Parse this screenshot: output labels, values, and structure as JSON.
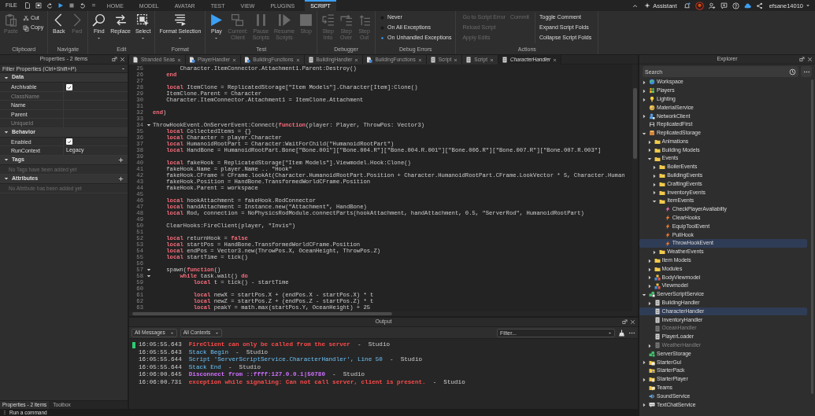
{
  "menu": {
    "file": "FILE",
    "tabs": [
      {
        "label": "HOME",
        "selected": false
      },
      {
        "label": "MODEL",
        "selected": false
      },
      {
        "label": "AVATAR",
        "selected": false
      },
      {
        "label": "TEST",
        "selected": false
      },
      {
        "label": "VIEW",
        "selected": false
      },
      {
        "label": "PLUGINS",
        "selected": false
      },
      {
        "label": "SCRIPT",
        "selected": true
      }
    ]
  },
  "account": {
    "assistant": "Assistant",
    "user": "efsane14010"
  },
  "ribbon": [
    {
      "label": "Clipboard",
      "kind": "buttons",
      "buttons": [
        {
          "lines": [
            "Paste"
          ],
          "kind": "large",
          "disabled": true,
          "dropdown": false
        },
        {
          "lines": [
            "Cut"
          ],
          "kind": "small",
          "disabled": false,
          "dropdown": false
        },
        {
          "lines": [
            "Copy"
          ],
          "kind": "small",
          "disabled": false,
          "dropdown": false
        }
      ]
    },
    {
      "label": "Navigate",
      "kind": "buttons",
      "buttons": [
        {
          "lines": [
            "Back"
          ],
          "kind": "large",
          "disabled": false,
          "dropdown": false
        },
        {
          "lines": [
            "Fwd"
          ],
          "kind": "large",
          "disabled": true,
          "dropdown": false
        }
      ]
    },
    {
      "label": "Edit",
      "kind": "buttons",
      "buttons": [
        {
          "lines": [
            "Find"
          ],
          "kind": "large",
          "disabled": false,
          "dropdown": true
        },
        {
          "lines": [
            "Replace"
          ],
          "kind": "large",
          "disabled": false,
          "dropdown": false
        },
        {
          "lines": [
            "Select"
          ],
          "kind": "large",
          "disabled": false,
          "dropdown": true
        }
      ]
    },
    {
      "label": "Format",
      "kind": "buttons",
      "buttons": [
        {
          "lines": [
            "Format Selection"
          ],
          "kind": "large",
          "disabled": false,
          "dropdown": true
        }
      ]
    },
    {
      "label": "Test",
      "kind": "buttons",
      "buttons": [
        {
          "lines": [
            "Play"
          ],
          "kind": "large",
          "disabled": false,
          "dropdown": true
        },
        {
          "lines": [
            "Current:",
            "Client"
          ],
          "kind": "large",
          "disabled": true,
          "dropdown": false
        },
        {
          "lines": [
            "Pause",
            "Scripts"
          ],
          "kind": "large",
          "disabled": true,
          "dropdown": false
        },
        {
          "lines": [
            "Resume",
            "Scripts"
          ],
          "kind": "large",
          "disabled": true,
          "dropdown": false
        },
        {
          "lines": [
            "Stop"
          ],
          "kind": "large",
          "disabled": true,
          "dropdown": false
        }
      ]
    },
    {
      "label": "Debugger",
      "kind": "buttons",
      "buttons": [
        {
          "lines": [
            "Step",
            "Into"
          ],
          "kind": "large",
          "disabled": true,
          "dropdown": false
        },
        {
          "lines": [
            "Step",
            "Over"
          ],
          "kind": "large",
          "disabled": true,
          "dropdown": false
        },
        {
          "lines": [
            "Step",
            "Out"
          ],
          "kind": "large",
          "disabled": true,
          "dropdown": false
        }
      ]
    },
    {
      "label": "Debug Errors",
      "kind": "radios",
      "options": [
        {
          "label": "Never",
          "selected": false
        },
        {
          "label": "On All Exceptions",
          "selected": false
        },
        {
          "label": "On Unhandled Exceptions",
          "selected": true
        }
      ]
    },
    {
      "label": "Actions",
      "kind": "actions",
      "columns": [
        [
          [
            {
              "label": "Go to Script Error",
              "disabled": true
            },
            {
              "label": "Commit",
              "disabled": true
            }
          ],
          [
            {
              "label": "Reload Script",
              "disabled": true
            }
          ],
          [
            {
              "label": "Apply Edits",
              "disabled": true
            }
          ]
        ],
        [
          [
            {
              "label": "Toggle Comment",
              "disabled": false
            }
          ],
          [
            {
              "label": "Expand Script Folds",
              "disabled": false
            }
          ],
          [
            {
              "label": "Collapse Script Folds",
              "disabled": false
            }
          ]
        ]
      ]
    }
  ],
  "properties": {
    "title": "Properties - 2 items",
    "filter": {
      "placeholder": "Filter Properties (Ctrl+Shift+P)"
    },
    "sections": [
      {
        "title": "Data",
        "expanded": true,
        "addable": false,
        "rows": [
          {
            "name": "Archivable",
            "kind": "checkbox",
            "checked": true,
            "disabled": false
          },
          {
            "name": "ClassName",
            "kind": "text",
            "disabled": true
          },
          {
            "name": "Name",
            "kind": "text",
            "disabled": false
          },
          {
            "name": "Parent",
            "kind": "text",
            "disabled": false
          },
          {
            "name": "UniqueId",
            "kind": "text",
            "disabled": true
          }
        ]
      },
      {
        "title": "Behavior",
        "expanded": true,
        "addable": false,
        "rows": [
          {
            "name": "Enabled",
            "kind": "checkbox",
            "checked": true,
            "disabled": false
          },
          {
            "name": "RunContext",
            "kind": "text",
            "value": "Legacy",
            "disabled": false
          }
        ]
      },
      {
        "title": "Tags",
        "expanded": true,
        "addable": true,
        "empty_text": "No Tags have been added yet"
      },
      {
        "title": "Attributes",
        "expanded": true,
        "addable": true,
        "empty_text": "No Attribute has been added yet"
      }
    ],
    "tabs": [
      {
        "label": "Properties - 2 items",
        "selected": true
      },
      {
        "label": "Toolbox",
        "selected": false
      }
    ]
  },
  "editor": {
    "tabs": [
      {
        "label": "Stranded Seas",
        "kind": "place",
        "selected": false,
        "preview": false
      },
      {
        "label": "PlayerHandler",
        "kind": "module",
        "selected": false,
        "preview": false
      },
      {
        "label": "BuildingFunctions",
        "kind": "module",
        "selected": false,
        "preview": false
      },
      {
        "label": "BuildingHandler",
        "kind": "script",
        "selected": false,
        "preview": false
      },
      {
        "label": "BuildingFunctions",
        "kind": "module",
        "selected": false,
        "preview": false
      },
      {
        "label": "Script",
        "kind": "script",
        "selected": false,
        "preview": false
      },
      {
        "label": "Script",
        "kind": "script",
        "selected": false,
        "preview": false
      },
      {
        "label": "CharacterHandler",
        "kind": "script",
        "selected": true,
        "preview": true
      }
    ],
    "lines": [
      {
        "n": "25",
        "foldable": false,
        "code": "        Character.ItemConnector.Attachment1.Parent:Destroy()"
      },
      {
        "n": "26",
        "foldable": false,
        "code": "    **end**"
      },
      {
        "n": "27",
        "foldable": false
      },
      {
        "n": "28",
        "foldable": false,
        "code": "    **local** ItemClone = ReplicatedStorage[\"Item Models\"].Character[Item]:Clone()"
      },
      {
        "n": "29",
        "foldable": false,
        "code": "    ItemClone.Parent = Character"
      },
      {
        "n": "30",
        "foldable": false,
        "code": "    Character.ItemConnector.Attachment1 = ItemClone.Attachment"
      },
      {
        "n": "31",
        "foldable": false
      },
      {
        "n": "32",
        "foldable": false,
        "code": "**end**)"
      },
      {
        "n": "33",
        "foldable": false
      },
      {
        "n": "34",
        "foldable": true,
        "code": "ThrowHookEvent.OnServerEvent:Connect(**function**(player: Player, ThrowPos: Vector3)"
      },
      {
        "n": "35",
        "foldable": false,
        "code": "    **local** CollectedItems = {}"
      },
      {
        "n": "36",
        "foldable": false,
        "code": "    **local** Character = player.Character"
      },
      {
        "n": "37",
        "foldable": false,
        "code": "    **local** HumanoidRootPart = Character:WaitForChild(\"HumanoidRootPart\")"
      },
      {
        "n": "38",
        "foldable": false,
        "code": "    **local** HandBone = HumanoidRootPart.Bone[\"Bone.001\"][\"Bone.004.R\"][\"Bone.004.R.001\"][\"Bone.006.R\"][\"Bone.007.R\"][\"Bone.007.R.003\"]"
      },
      {
        "n": "39",
        "foldable": false
      },
      {
        "n": "40",
        "foldable": false,
        "code": "    **local** fakeHook = ReplicatedStorage[\"Item Models\"].Viewmodel.Hook:Clone()"
      },
      {
        "n": "41",
        "foldable": false,
        "code": "    fakeHook.Name = player.Name .. \"Hook\""
      },
      {
        "n": "42",
        "foldable": false,
        "code": "    fakeHook.CFrame = CFrame.lookAt(Character.HumanoidRootPart.Position + Character.HumanoidRootPart.CFrame.LookVector * 5, Character.Human"
      },
      {
        "n": "43",
        "foldable": false,
        "code": "    fakeHook.Position = HandBone.TransformedWorldCFrame.Position"
      },
      {
        "n": "44",
        "foldable": false,
        "code": "    fakeHook.Parent = workspace"
      },
      {
        "n": "45",
        "foldable": false
      },
      {
        "n": "46",
        "foldable": false,
        "code": "    **local** hookAttachment = fakeHook.RodConnector"
      },
      {
        "n": "47",
        "foldable": false,
        "code": "    **local** handAttachment = Instance.new(\"Attachment\", HandBone)"
      },
      {
        "n": "48",
        "foldable": false,
        "code": "    **local** Rod, connection = NoPhysicsRodModule.connectParts(hookAttachment, handAttachment, 0.5, \"ServerRod\", HumanoidRootPart)"
      },
      {
        "n": "49",
        "foldable": false
      },
      {
        "n": "50",
        "foldable": false,
        "code": "    ClearHooks:FireClient(player, \"Invis\")"
      },
      {
        "n": "51",
        "foldable": false
      },
      {
        "n": "52",
        "foldable": false,
        "code": "    **local** returnHook = **false**"
      },
      {
        "n": "53",
        "foldable": false,
        "code": "    **local** startPos = HandBone.TransformedWorldCFrame.Position"
      },
      {
        "n": "54",
        "foldable": false,
        "code": "    **local** endPos = Vector3.new(ThrowPos.X, OceanHeight, ThrowPos.Z)"
      },
      {
        "n": "55",
        "foldable": false,
        "code": "    **local** startTime = tick()"
      },
      {
        "n": "56",
        "foldable": false
      },
      {
        "n": "57",
        "foldable": true,
        "code": "    spawn(**function**()"
      },
      {
        "n": "58",
        "foldable": true,
        "code": "        **while** task.wait() **do**"
      },
      {
        "n": "59",
        "foldable": false,
        "code": "            **local** t = tick() - startTime"
      },
      {
        "n": "60",
        "foldable": false
      },
      {
        "n": "61",
        "foldable": false,
        "code": "            **local** newX = startPos.X + (endPos.X - startPos.X) * t"
      },
      {
        "n": "62",
        "foldable": false,
        "code": "            **local** newZ = startPos.Z + (endPos.Z - startPos.Z) * t"
      },
      {
        "n": "63",
        "foldable": false,
        "code": "            **local** peakY = math.max(startPos.Y, OceanHeight) + 25"
      }
    ]
  },
  "output": {
    "title": "Output",
    "filters": [
      {
        "label": "All Messages"
      },
      {
        "label": "All Contexts"
      }
    ],
    "search": {
      "placeholder": "Filter..."
    },
    "messages": [
      {
        "time": "16:05:55.643",
        "text": "FireClient can only be called from the server",
        "source": "-  Studio",
        "kind": "error",
        "marked": true
      },
      {
        "time": "16:05:55.643",
        "text": "Stack Begin",
        "source": "-  Studio",
        "kind": "info",
        "marked": false
      },
      {
        "time": "16:05:55.644",
        "text": "Script 'ServerScriptService.CharacterHandler', Line 50",
        "source": "-  Studio",
        "kind": "info",
        "marked": false
      },
      {
        "time": "16:05:55.644",
        "text": "Stack End",
        "source": "-  Studio",
        "kind": "info",
        "marked": false
      },
      {
        "time": "16:06:00.645",
        "text": "Disconnect from ::ffff:127.0.0.1|50780",
        "source": "-  Studio",
        "kind": "network",
        "marked": false
      },
      {
        "time": "16:06:00.731",
        "text": "exception while signaling: Can not call server, client is present.",
        "source": "-  Studio",
        "kind": "error",
        "marked": false
      }
    ]
  },
  "explorer": {
    "title": "Explorer",
    "search": {
      "placeholder": "Search"
    },
    "items": [
      {
        "label": "Workspace",
        "kind": "workspace",
        "expandable": true,
        "expanded": false,
        "selected": false,
        "disabled": false
      },
      {
        "label": "Players",
        "kind": "players",
        "expandable": true,
        "expanded": false,
        "selected": false,
        "disabled": false
      },
      {
        "label": "Lighting",
        "kind": "lighting",
        "expandable": true,
        "expanded": false,
        "selected": false,
        "disabled": false
      },
      {
        "label": "MaterialService",
        "kind": "material",
        "expandable": false,
        "selected": false,
        "disabled": false
      },
      {
        "label": "NetworkClient",
        "kind": "network",
        "expandable": true,
        "expanded": false,
        "selected": false,
        "disabled": false
      },
      {
        "label": "ReplicatedFirst",
        "kind": "replicatedfirst",
        "expandable": false,
        "selected": false,
        "disabled": false
      },
      {
        "label": "ReplicatedStorage",
        "kind": "replicatedstorage",
        "expandable": true,
        "expanded": true,
        "selected": false,
        "disabled": false,
        "children": [
          {
            "label": "Animations",
            "kind": "folder",
            "expandable": true,
            "expanded": false,
            "selected": false,
            "disabled": false
          },
          {
            "label": "Building Models",
            "kind": "folder",
            "expandable": true,
            "expanded": false,
            "selected": false,
            "disabled": false
          },
          {
            "label": "Events",
            "kind": "folder",
            "expandable": true,
            "expanded": true,
            "selected": false,
            "disabled": false,
            "children": [
              {
                "label": "BoilerEvents",
                "kind": "folder",
                "expandable": true,
                "expanded": false,
                "selected": false,
                "disabled": false
              },
              {
                "label": "BuildingEvents",
                "kind": "folder",
                "expandable": true,
                "expanded": false,
                "selected": false,
                "disabled": false
              },
              {
                "label": "CraftingEvents",
                "kind": "folder",
                "expandable": true,
                "expanded": false,
                "selected": false,
                "disabled": false
              },
              {
                "label": "InventoryEvents",
                "kind": "folder",
                "expandable": true,
                "expanded": false,
                "selected": false,
                "disabled": false
              },
              {
                "label": "ItemEvents",
                "kind": "folder",
                "expandable": true,
                "expanded": true,
                "selected": false,
                "disabled": false,
                "children": [
                  {
                    "label": "CheckPlayerAvaliabilty",
                    "kind": "remotefunction",
                    "expandable": false,
                    "selected": false,
                    "disabled": false
                  },
                  {
                    "label": "ClearHooks",
                    "kind": "remoteevent",
                    "expandable": false,
                    "selected": false,
                    "disabled": false
                  },
                  {
                    "label": "EquipToolEvent",
                    "kind": "remoteevent",
                    "expandable": false,
                    "selected": false,
                    "disabled": false
                  },
                  {
                    "label": "PullHook",
                    "kind": "remoteevent",
                    "expandable": false,
                    "selected": false,
                    "disabled": false
                  },
                  {
                    "label": "ThrowHookEvent",
                    "kind": "remoteevent",
                    "expandable": false,
                    "selected": true,
                    "disabled": false
                  }
                ]
              },
              {
                "label": "WeatherEvents",
                "kind": "folder",
                "expandable": true,
                "expanded": false,
                "selected": false,
                "disabled": false
              }
            ]
          },
          {
            "label": "Item Models",
            "kind": "folder",
            "expandable": true,
            "expanded": false,
            "selected": false,
            "disabled": false
          },
          {
            "label": "Modules",
            "kind": "folder",
            "expandable": true,
            "expanded": false,
            "selected": false,
            "disabled": false
          },
          {
            "label": "BodyViewmodel",
            "kind": "model",
            "expandable": true,
            "expanded": false,
            "selected": false,
            "disabled": false
          },
          {
            "label": "Viewmodel",
            "kind": "model",
            "expandable": true,
            "expanded": false,
            "selected": false,
            "disabled": false
          }
        ]
      },
      {
        "label": "ServerScriptService",
        "kind": "serverscriptservice",
        "expandable": true,
        "expanded": true,
        "selected": false,
        "disabled": false,
        "children": [
          {
            "label": "BuildingHandler",
            "kind": "script",
            "expandable": true,
            "expanded": false,
            "selected": false,
            "disabled": false
          },
          {
            "label": "CharacterHandler",
            "kind": "script",
            "expandable": false,
            "selected": true,
            "disabled": false
          },
          {
            "label": "InventoryHandler",
            "kind": "script",
            "expandable": false,
            "selected": false,
            "disabled": false
          },
          {
            "label": "OceanHandler",
            "kind": "script",
            "expandable": false,
            "selected": false,
            "disabled": true
          },
          {
            "label": "PlayerLoader",
            "kind": "script",
            "expandable": false,
            "selected": false,
            "disabled": false
          },
          {
            "label": "WeatherHandler",
            "kind": "script",
            "expandable": true,
            "expanded": false,
            "selected": false,
            "disabled": true
          }
        ]
      },
      {
        "label": "ServerStorage",
        "kind": "serverstorage",
        "expandable": false,
        "selected": false,
        "disabled": false
      },
      {
        "label": "StarterGui",
        "kind": "startergui",
        "expandable": true,
        "expanded": false,
        "selected": false,
        "disabled": false
      },
      {
        "label": "StarterPack",
        "kind": "starterpack",
        "expandable": false,
        "selected": false,
        "disabled": false
      },
      {
        "label": "StarterPlayer",
        "kind": "starterplayer",
        "expandable": true,
        "expanded": false,
        "selected": false,
        "disabled": false
      },
      {
        "label": "Teams",
        "kind": "teams",
        "expandable": false,
        "selected": false,
        "disabled": false
      },
      {
        "label": "SoundService",
        "kind": "sound",
        "expandable": false,
        "selected": false,
        "disabled": false
      },
      {
        "label": "TextChatService",
        "kind": "textchat",
        "expandable": true,
        "expanded": false,
        "selected": false,
        "disabled": false
      }
    ]
  },
  "command_bar": {
    "placeholder": "Run a command"
  }
}
